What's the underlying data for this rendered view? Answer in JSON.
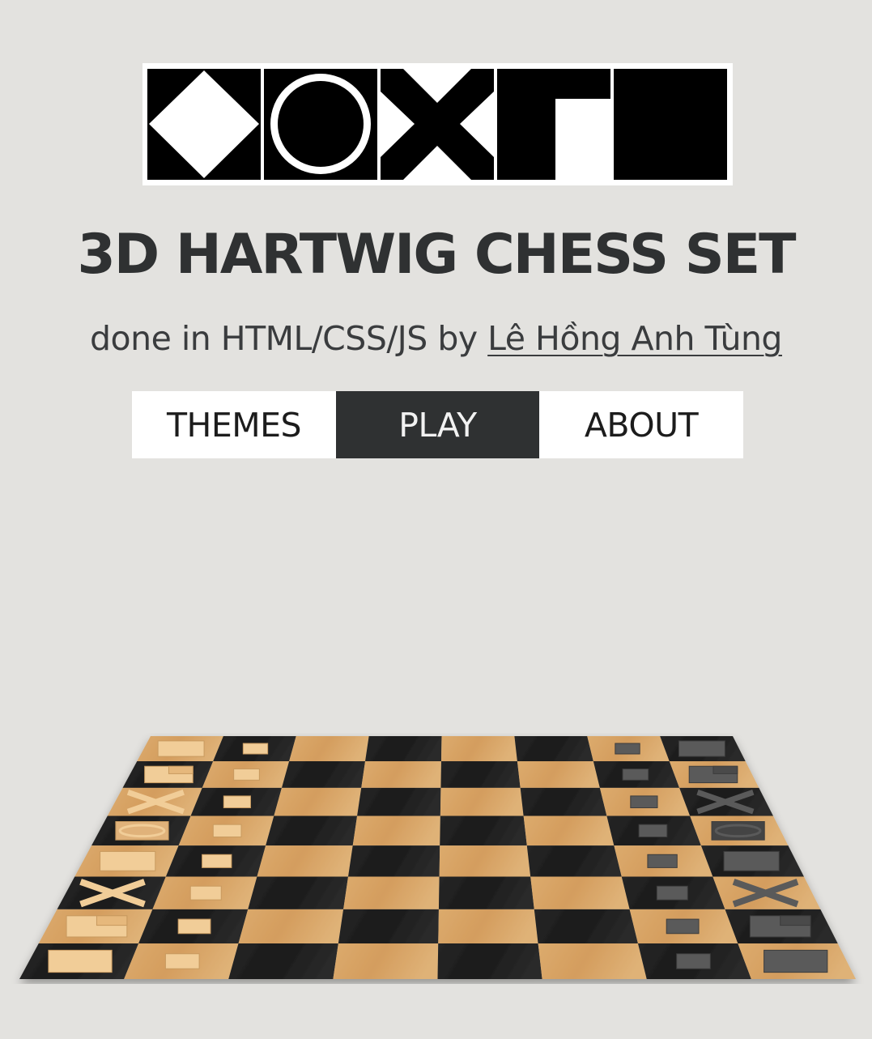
{
  "logo": {
    "glyphs": [
      "diamond-icon",
      "ring-icon",
      "cross-icon",
      "corner-icon",
      "square-icon"
    ]
  },
  "title": "3D HARTWIG CHESS SET",
  "subtitle": {
    "prefix": "done in HTML/CSS/JS by ",
    "author": "Lê Hồng Anh Tùng"
  },
  "nav": {
    "tabs": [
      {
        "label": "THEMES",
        "active": false
      },
      {
        "label": "PLAY",
        "active": true
      },
      {
        "label": "ABOUT",
        "active": false
      }
    ]
  },
  "board": {
    "files": 8,
    "ranks": 8,
    "colors": {
      "light": "#d8a466",
      "dark": "#1f1f1f",
      "light_piece": "#f1cd98",
      "dark_piece": "#5a5a5a",
      "background": "#e3e2df",
      "accent": "#2f3132"
    },
    "pieces_light": [
      [
        "rook",
        "pawn"
      ],
      [
        "knight",
        "pawn"
      ],
      [
        "bishop",
        "pawn"
      ],
      [
        "queen",
        "pawn"
      ],
      [
        "king",
        "pawn"
      ],
      [
        "bishop",
        "pawn"
      ],
      [
        "knight",
        "pawn"
      ],
      [
        "rook",
        "pawn"
      ]
    ],
    "pieces_dark": [
      [
        "pawn",
        "rook"
      ],
      [
        "pawn",
        "knight"
      ],
      [
        "pawn",
        "bishop"
      ],
      [
        "pawn",
        "queen"
      ],
      [
        "pawn",
        "king"
      ],
      [
        "pawn",
        "bishop"
      ],
      [
        "pawn",
        "knight"
      ],
      [
        "pawn",
        "rook"
      ]
    ]
  }
}
